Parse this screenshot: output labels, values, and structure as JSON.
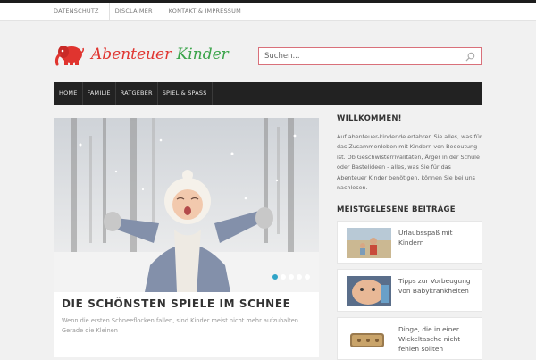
{
  "top_links": [
    "DATENSCHUTZ",
    "DISCLAIMER",
    "KONTAKT & IMPRESSUM"
  ],
  "logo": {
    "word1": "Abenteuer",
    "word2": "Kinder"
  },
  "search": {
    "placeholder": "Suchen..."
  },
  "nav": [
    "HOME",
    "FAMILIE",
    "RATGEBER",
    "SPIEL & SPASS"
  ],
  "slider": {
    "title": "DIE SCHÖNSTEN SPIELE IM SCHNEE",
    "excerpt": "Wenn die ersten Schneeflocken fallen, sind Kinder meist nicht mehr aufzuhalten. Gerade die Kleinen",
    "dots": 5,
    "active_dot": 1
  },
  "sidebar": {
    "welcome_title": "WILLKOMMEN!",
    "welcome_text": "Auf abenteuer-kinder.de erfahren Sie alles, was für das Zusammenleben mit Kindern von Bedeutung ist. Ob Geschwisterrivalitäten, Ärger in der Schule oder Bastelideen - alles, was Sie für das Abenteuer Kinder benötigen, können Sie bei uns nachlesen.",
    "popular_title": "MEISTGELESENE BEITRÄGE",
    "popular": [
      {
        "title": "Urlaubsspaß mit Kindern"
      },
      {
        "title": "Tipps zur Vorbeugung von Babykrankheiten"
      },
      {
        "title": "Dinge, die in einer Wickeltasche nicht fehlen sollten"
      }
    ]
  },
  "colors": {
    "nav_bg": "#222222",
    "search_border": "#d9707a",
    "slider_active_dot": "#2fa4c7",
    "logo_red": "#e0342f",
    "logo_green": "#3aa44a"
  }
}
